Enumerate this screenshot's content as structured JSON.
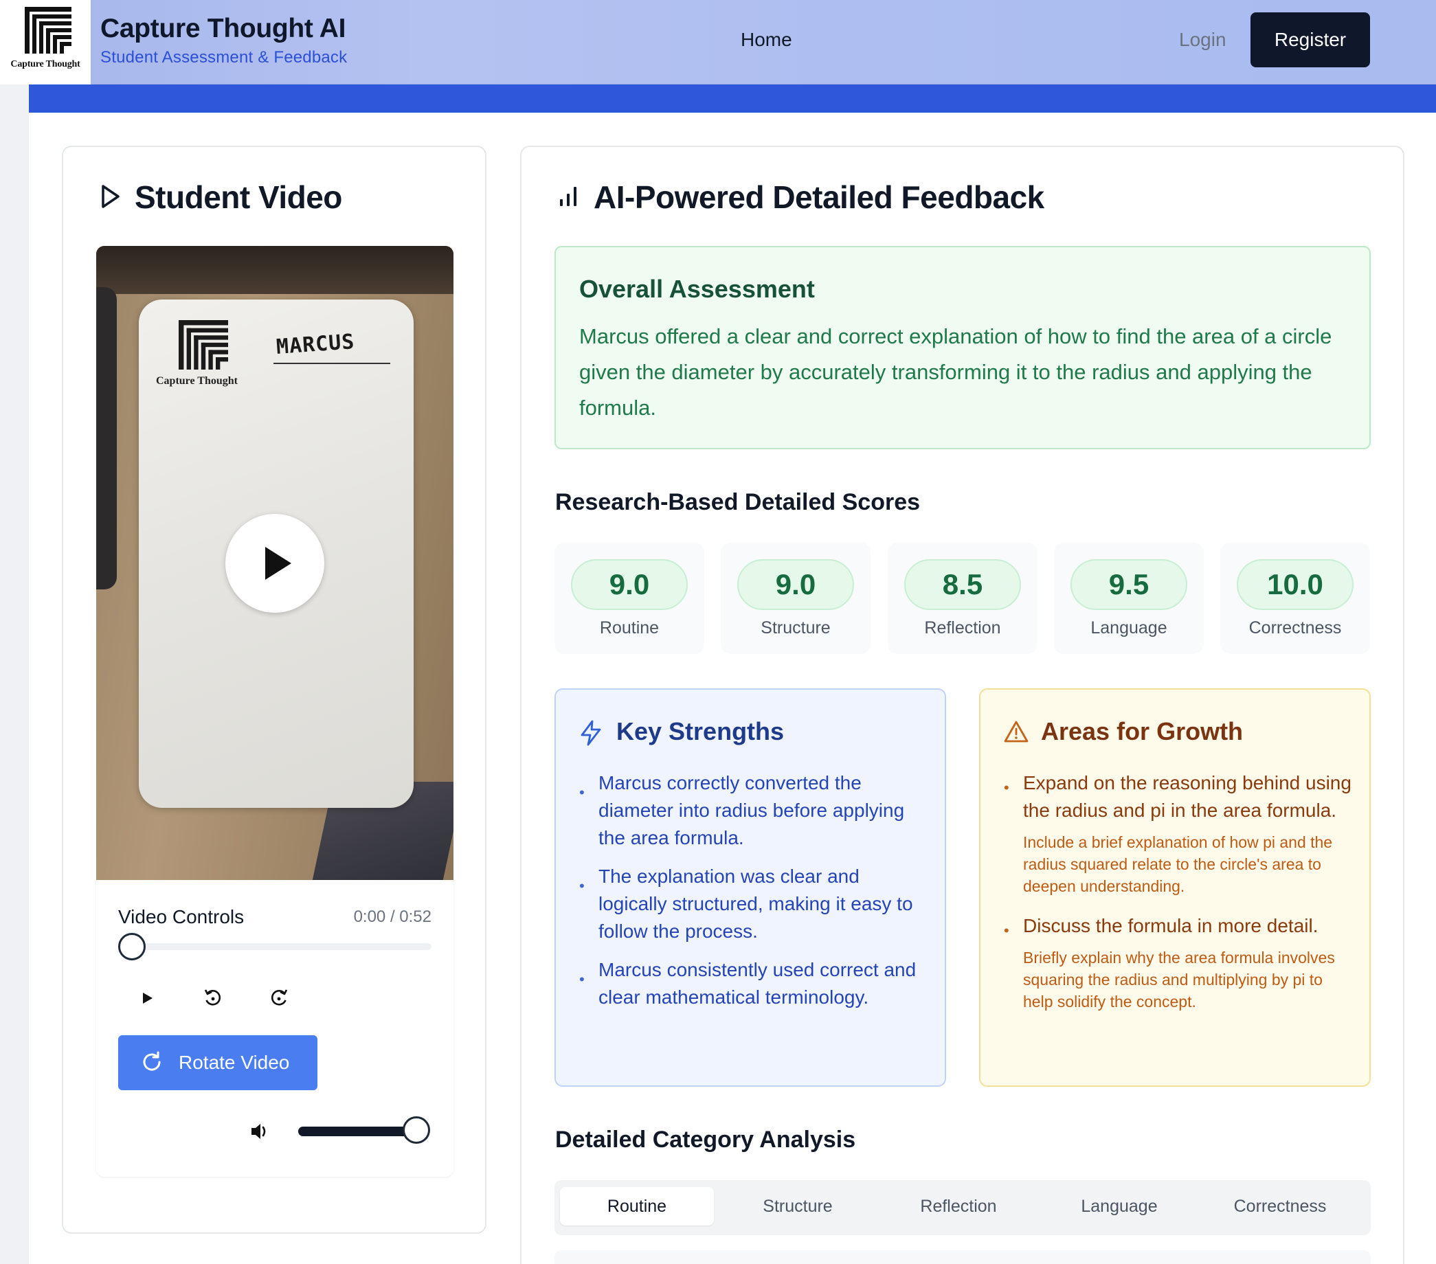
{
  "brand": {
    "logo_word": "Capture Thought",
    "title": "Capture Thought AI",
    "subtitle": "Student Assessment & Feedback"
  },
  "nav": {
    "home": "Home",
    "login": "Login",
    "register": "Register"
  },
  "video_card": {
    "heading": "Student Video",
    "whiteboard_logo_word": "Capture Thought",
    "whiteboard_name": "MARCUS",
    "controls_label": "Video Controls",
    "time": "0:00 / 0:52",
    "progress": 0,
    "volume": 1.0,
    "rotate_label": "Rotate Video"
  },
  "feedback_card": {
    "heading": "AI-Powered Detailed Feedback",
    "overall": {
      "title": "Overall Assessment",
      "text": "Marcus offered a clear and correct explanation of how to find the area of a circle given the diameter by accurately transforming it to the radius and applying the formula."
    },
    "scores_heading": "Research-Based Detailed Scores",
    "scores": [
      {
        "value": "9.0",
        "label": "Routine"
      },
      {
        "value": "9.0",
        "label": "Structure"
      },
      {
        "value": "8.5",
        "label": "Reflection"
      },
      {
        "value": "9.5",
        "label": "Language"
      },
      {
        "value": "10.0",
        "label": "Correctness"
      }
    ],
    "strengths": {
      "title": "Key Strengths",
      "items": [
        "Marcus correctly converted the diameter into radius before applying the area formula.",
        "The explanation was clear and logically structured, making it easy to follow the process.",
        "Marcus consistently used correct and clear mathematical terminology."
      ]
    },
    "growth": {
      "title": "Areas for Growth",
      "items": [
        {
          "main": "Expand on the reasoning behind using the radius and pi in the area formula.",
          "detail": "Include a brief explanation of how pi and the radius squared relate to the circle's area to deepen understanding."
        },
        {
          "main": "Discuss the formula in more detail.",
          "detail": "Briefly explain why the area formula involves squaring the radius and multiplying by pi to help solidify the concept."
        }
      ]
    },
    "category_heading": "Detailed Category Analysis",
    "tabs": [
      "Routine",
      "Structure",
      "Reflection",
      "Language",
      "Correctness"
    ],
    "active_tab": "Routine"
  },
  "colors": {
    "accent_blue": "#2f57d9",
    "button_blue": "#4a7ef0",
    "dark": "#0f172a",
    "score_green": "#176c3f"
  },
  "icons": {
    "video_heading": "play-outline-icon",
    "feedback_heading": "bar-chart-icon",
    "strengths": "lightning-icon",
    "growth": "warning-triangle-icon",
    "rotate": "rotate-cw-icon",
    "volume": "speaker-icon"
  }
}
